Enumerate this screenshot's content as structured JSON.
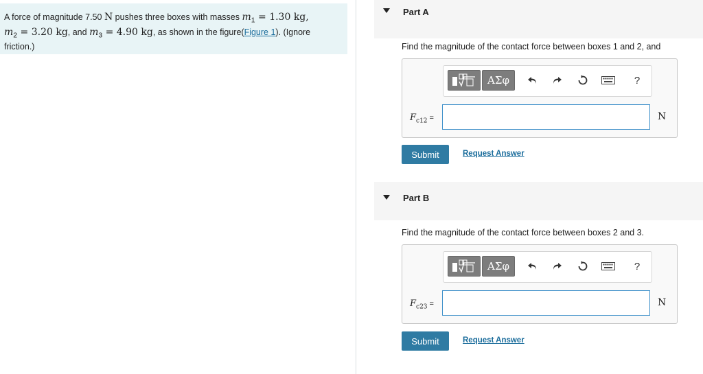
{
  "problem": {
    "text_1": "A force of magnitude 7.50 ",
    "unit_force": "N",
    "text_2": " pushes three boxes with masses ",
    "m1_sym": "m",
    "m1_sub": "1",
    "m1_val": " = 1.30 kg,",
    "m2_sym": "m",
    "m2_sub": "2",
    "m2_val": " = 3.20 kg",
    "text_3": ", and ",
    "m3_sym": "m",
    "m3_sub": "3",
    "m3_val": " = 4.90 kg",
    "text_4": ", as shown in the figure(",
    "figure_link": "Figure 1",
    "text_5": "). (Ignore friction.)"
  },
  "parts": [
    {
      "title": "Part A",
      "prompt": "Find the magnitude of the contact force between boxes 1 and 2, and",
      "var_symbol": "F",
      "var_sub": "c12",
      "var_eq": "=",
      "input_value": "",
      "unit": "N",
      "submit_label": "Submit",
      "request_label": "Request Answer"
    },
    {
      "title": "Part B",
      "prompt": "Find the magnitude of the contact force between boxes 2 and 3.",
      "var_symbol": "F",
      "var_sub": "c23",
      "var_eq": "=",
      "input_value": "",
      "unit": "N",
      "submit_label": "Submit",
      "request_label": "Request Answer"
    }
  ],
  "toolbar": {
    "symbols_label": "ΑΣφ",
    "help_label": "?"
  },
  "icons": {
    "collapse": "triangle-down-icon",
    "templates": "templates-icon",
    "undo": "undo-icon",
    "redo": "redo-icon",
    "reset": "reset-icon",
    "keyboard": "keyboard-icon"
  },
  "colors": {
    "problem_bg": "#e8f4f6",
    "submit_bg": "#2f7ba3",
    "link": "#1b6d9c",
    "input_border": "#3c8fc9"
  }
}
